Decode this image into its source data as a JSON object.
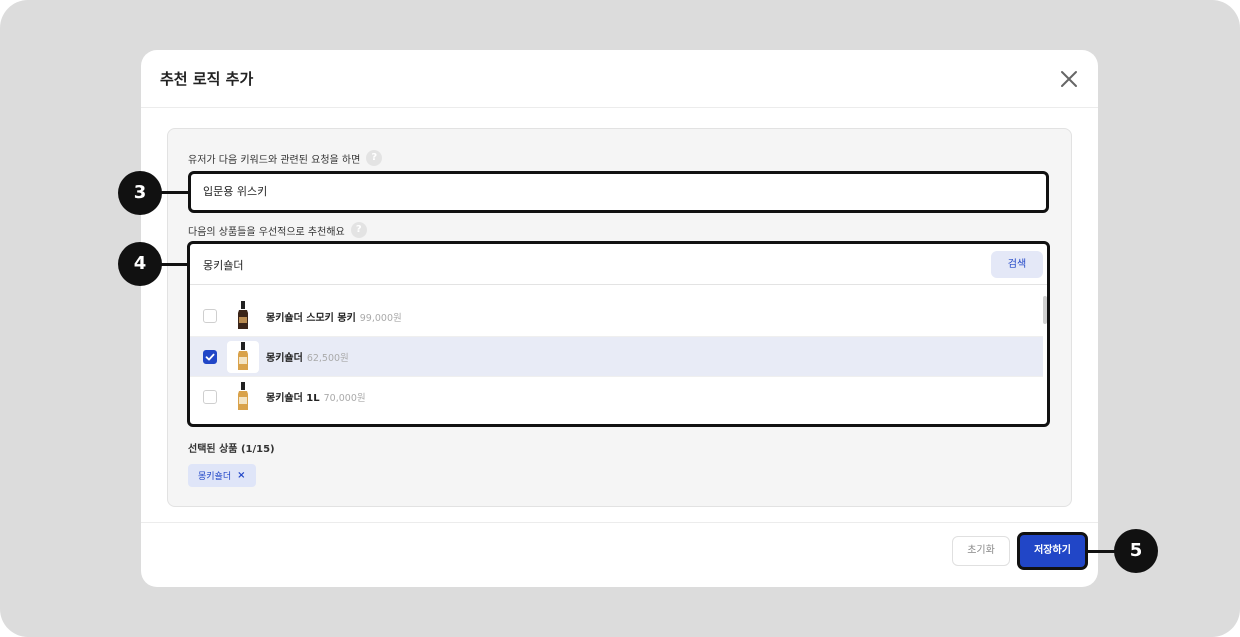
{
  "modal": {
    "title": "추천 로직 추가"
  },
  "form": {
    "keyword_label": "유저가 다음 키워드와 관련된 요청을 하면",
    "keyword_value": "입문용 위스키",
    "products_label": "다음의 상품들을 우선적으로 추천해요",
    "search_value": "몽키숄더",
    "search_button": "검색",
    "help_glyph": "?"
  },
  "results": [
    {
      "name": "몽키숄더 스모키 몽키",
      "price": "99,000원",
      "checked": false,
      "bottle": "dark"
    },
    {
      "name": "몽키숄더",
      "price": "62,500원",
      "checked": true,
      "bottle": "amber"
    },
    {
      "name": "몽키숄더 1L",
      "price": "70,000원",
      "checked": false,
      "bottle": "amber"
    }
  ],
  "selected": {
    "label": "선택된 상품 (1/15)",
    "chips": [
      {
        "label": "몽키숄더",
        "remove": "×"
      }
    ]
  },
  "footer": {
    "reset_button": "초기화",
    "save_button": "저장하기"
  },
  "callouts": {
    "keyword": "3",
    "products": "4",
    "save": "5"
  },
  "colors": {
    "accent": "#2146c7",
    "accent_light": "#e4e8f7",
    "selected_row": "#e8ebf6",
    "frame_bg": "#dcdcdc"
  },
  "icons": {
    "close": "close-icon",
    "check": "check-icon",
    "help": "help-icon"
  }
}
